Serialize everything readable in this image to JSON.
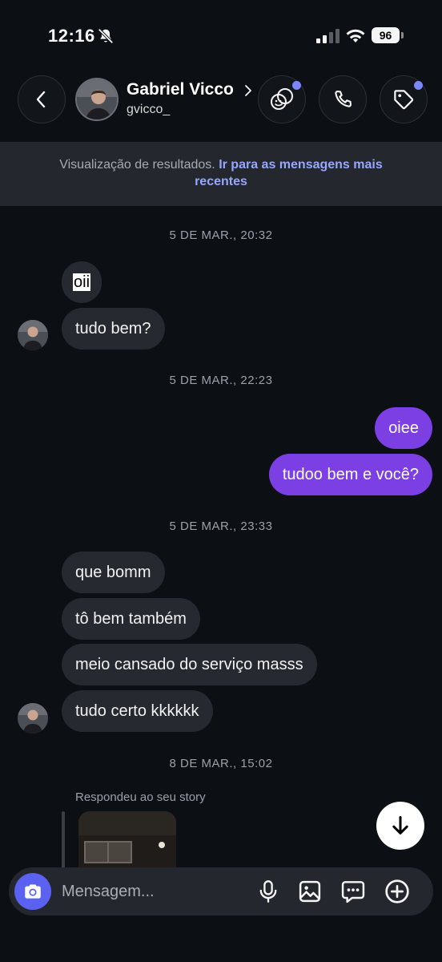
{
  "status_bar": {
    "time": "12:16",
    "battery": "96"
  },
  "header": {
    "name": "Gabriel Vicco",
    "handle": "gvicco_"
  },
  "banner": {
    "text": "Visualização de resultados.",
    "link": "Ir para as mensagens mais recentes"
  },
  "messages": {
    "date1": "5 DE MAR., 20:32",
    "m1": "oii",
    "m2": "tudo bem?",
    "date2": "5 DE MAR., 22:23",
    "m3": "oiee",
    "m4": "tudoo bem e você?",
    "date3": "5 DE MAR., 23:33",
    "m5": "que bomm",
    "m6": "tô bem também",
    "m7": "meio cansado do serviço masss",
    "m8": "tudo certo kkkkkk",
    "date4": "8 DE MAR., 15:02",
    "story_label": "Respondeu ao seu story"
  },
  "composer": {
    "placeholder": "Mensagem..."
  },
  "colors": {
    "outgoing": "#7c3fe4",
    "incoming": "#262a30",
    "accent": "#5b61f0",
    "link": "#97a6ff"
  },
  "icons": [
    "bell-slash-icon",
    "signal-icon",
    "wifi-icon",
    "back-chevron-icon",
    "effects-icon",
    "phone-icon",
    "tag-icon",
    "arrow-down-icon",
    "camera-icon",
    "microphone-icon",
    "image-icon",
    "chat-dots-icon",
    "plus-icon"
  ]
}
